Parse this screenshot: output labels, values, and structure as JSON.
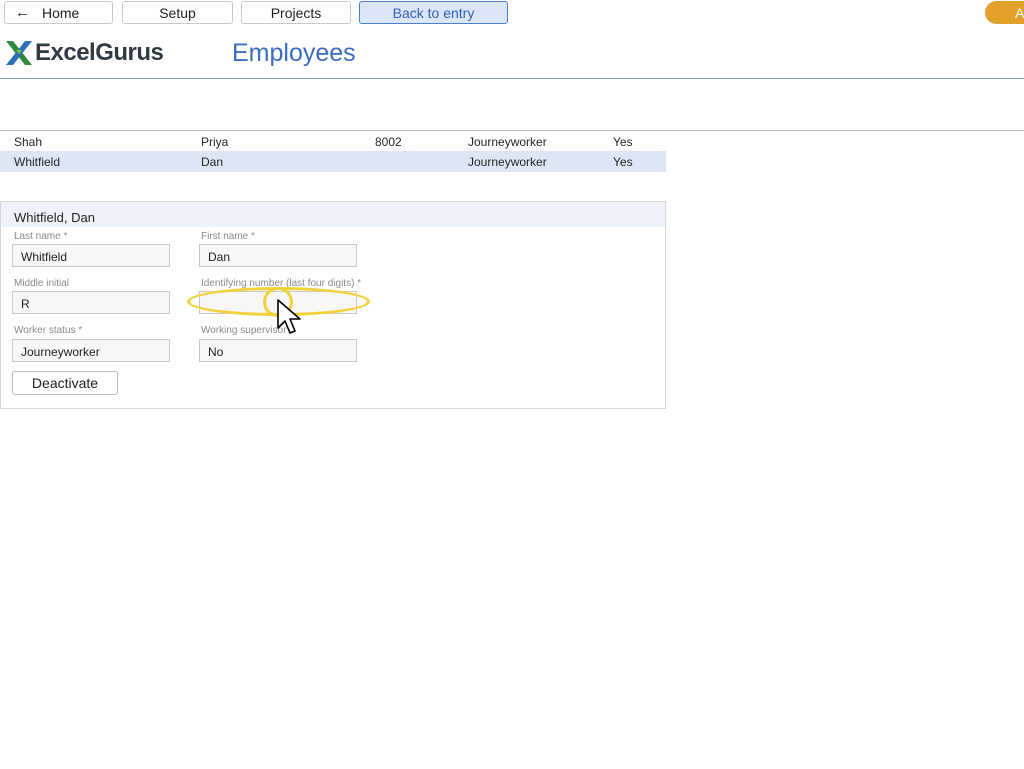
{
  "nav": {
    "home_label": "Home",
    "setup_label": "Setup",
    "projects_label": "Projects",
    "back_label": "Back to entry",
    "right_button_label": "A"
  },
  "header": {
    "logo_text": "ExcelGurus",
    "page_title": "Employees"
  },
  "employees": [
    {
      "last": "Shah",
      "first": "Priya",
      "id": "8002",
      "status": "Journeyworker",
      "active": "Yes"
    },
    {
      "last": "Whitfield",
      "first": "Dan",
      "id": "",
      "status": "Journeyworker",
      "active": "Yes",
      "selected": true
    }
  ],
  "detail": {
    "title": "Whitfield, Dan",
    "last_name_label": "Last name *",
    "last_name_value": "Whitfield",
    "first_name_label": "First name *",
    "first_name_value": "Dan",
    "middle_initial_label": "Middle initial",
    "middle_initial_value": "R",
    "identifying_number_label": "Identifying number (last four digits) *",
    "identifying_number_value": "",
    "worker_status_label": "Worker status *",
    "worker_status_value": "Journeyworker",
    "working_supervisor_label": "Working supervisor",
    "working_supervisor_value": "No",
    "deactivate_label": "Deactivate"
  },
  "colors": {
    "accent": "#3b6cc0",
    "highlight": "#f1d23a",
    "selected_row": "#dde6f5",
    "orange": "#e2a12a"
  }
}
